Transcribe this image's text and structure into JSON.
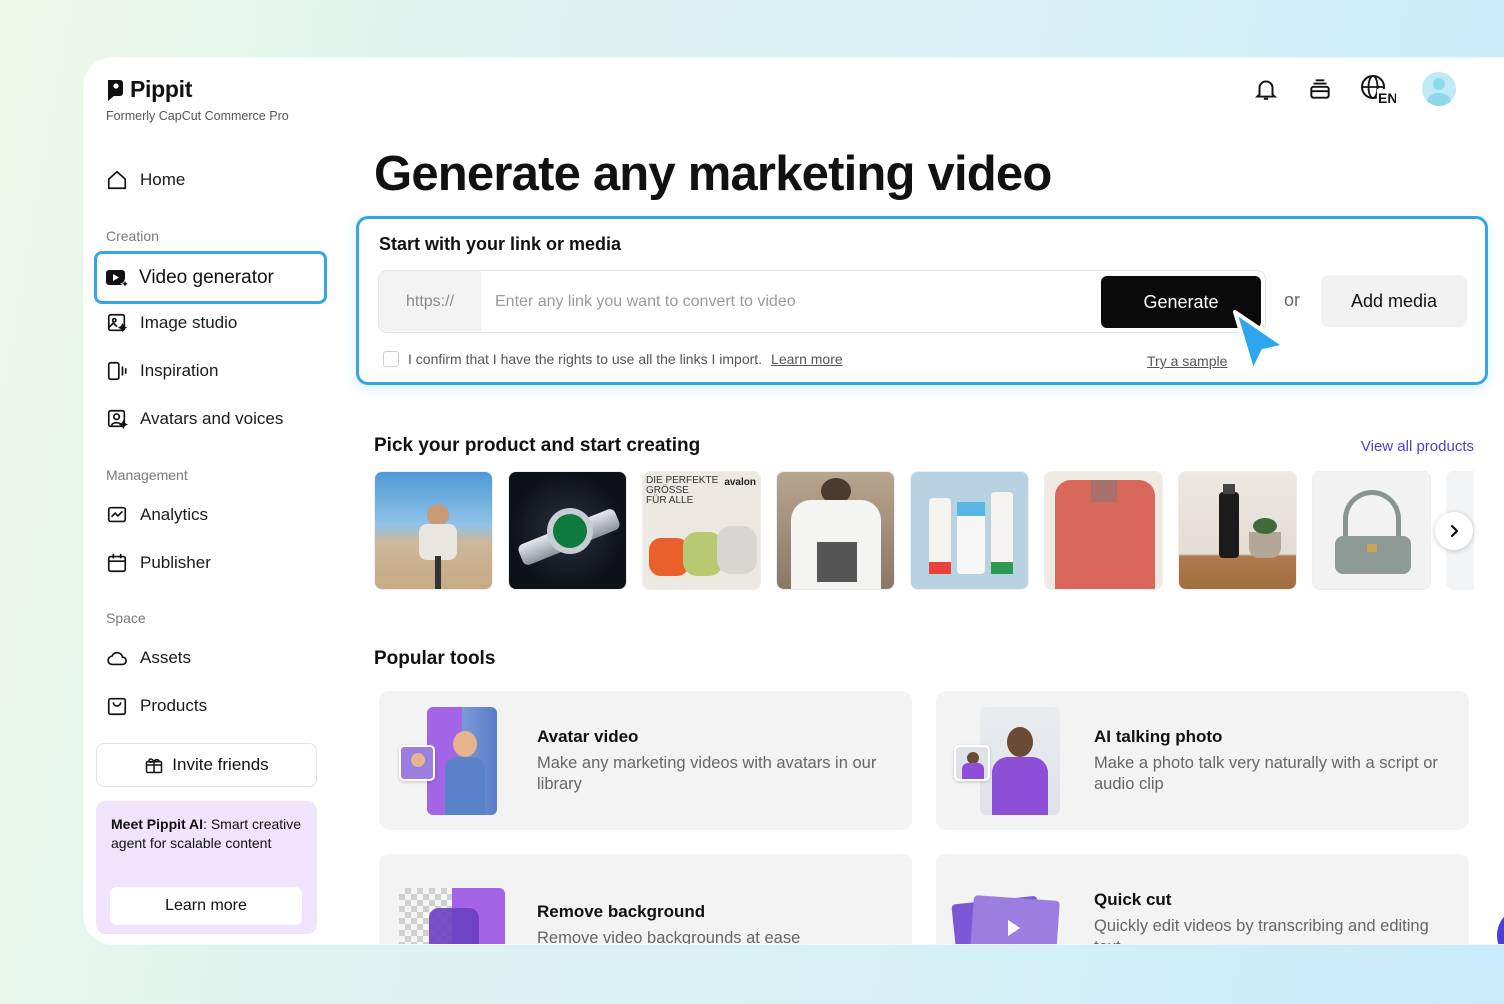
{
  "brand": {
    "name": "Pippit",
    "subtitle": "Formerly CapCut Commerce Pro"
  },
  "header": {
    "language_code": "EN",
    "icons": [
      "bell-icon",
      "layers-icon",
      "globe-icon",
      "user-avatar"
    ]
  },
  "sidebar": {
    "home": "Home",
    "sections": {
      "creation": "Creation",
      "management": "Management",
      "space": "Space"
    },
    "items": {
      "video_generator": "Video generator",
      "image_studio": "Image studio",
      "inspiration": "Inspiration",
      "avatars_voices": "Avatars and voices",
      "analytics": "Analytics",
      "publisher": "Publisher",
      "assets": "Assets",
      "products": "Products"
    },
    "invite": "Invite friends",
    "promo": {
      "bold": "Meet Pippit AI",
      "text": ": Smart creative agent for scalable content",
      "button": "Learn more"
    }
  },
  "main": {
    "headline": "Generate any marketing video",
    "link_card": {
      "title": "Start with your link or media",
      "prefix": "https://",
      "placeholder": "Enter any link you want to convert to video",
      "generate": "Generate",
      "or": "or",
      "add_media": "Add media",
      "confirm": "I confirm that I have the rights to use all the links I import.",
      "learn_more": "Learn more",
      "try_sample": "Try a sample"
    },
    "products": {
      "title": "Pick your product and start creating",
      "view_all": "View all products",
      "items": [
        "beach-photo",
        "green-watch",
        "bean-bags",
        "white-tshirt",
        "cream-tubes",
        "red-shirt",
        "spray-bottle",
        "handbag"
      ],
      "bean_bag_caption_1": "DIE PERFEKTE",
      "bean_bag_caption_2": "GRÖSSE",
      "bean_bag_caption_3": "FÜR ALLE",
      "bean_bag_brand": "avalon"
    },
    "tools": {
      "title": "Popular tools",
      "items": [
        {
          "title": "Avatar video",
          "desc": "Make any marketing videos with avatars in our library"
        },
        {
          "title": "AI talking photo",
          "desc": "Make a photo talk very naturally with a script or audio clip"
        },
        {
          "title": "Remove background",
          "desc": "Remove video backgrounds at ease"
        },
        {
          "title": "Quick cut",
          "desc": "Quickly edit videos by transcribing and editing text"
        }
      ]
    }
  },
  "colors": {
    "accent_blue": "#33a6ea",
    "brand_purple": "#4b3fd6",
    "promo_bg": "#efe4fb"
  }
}
